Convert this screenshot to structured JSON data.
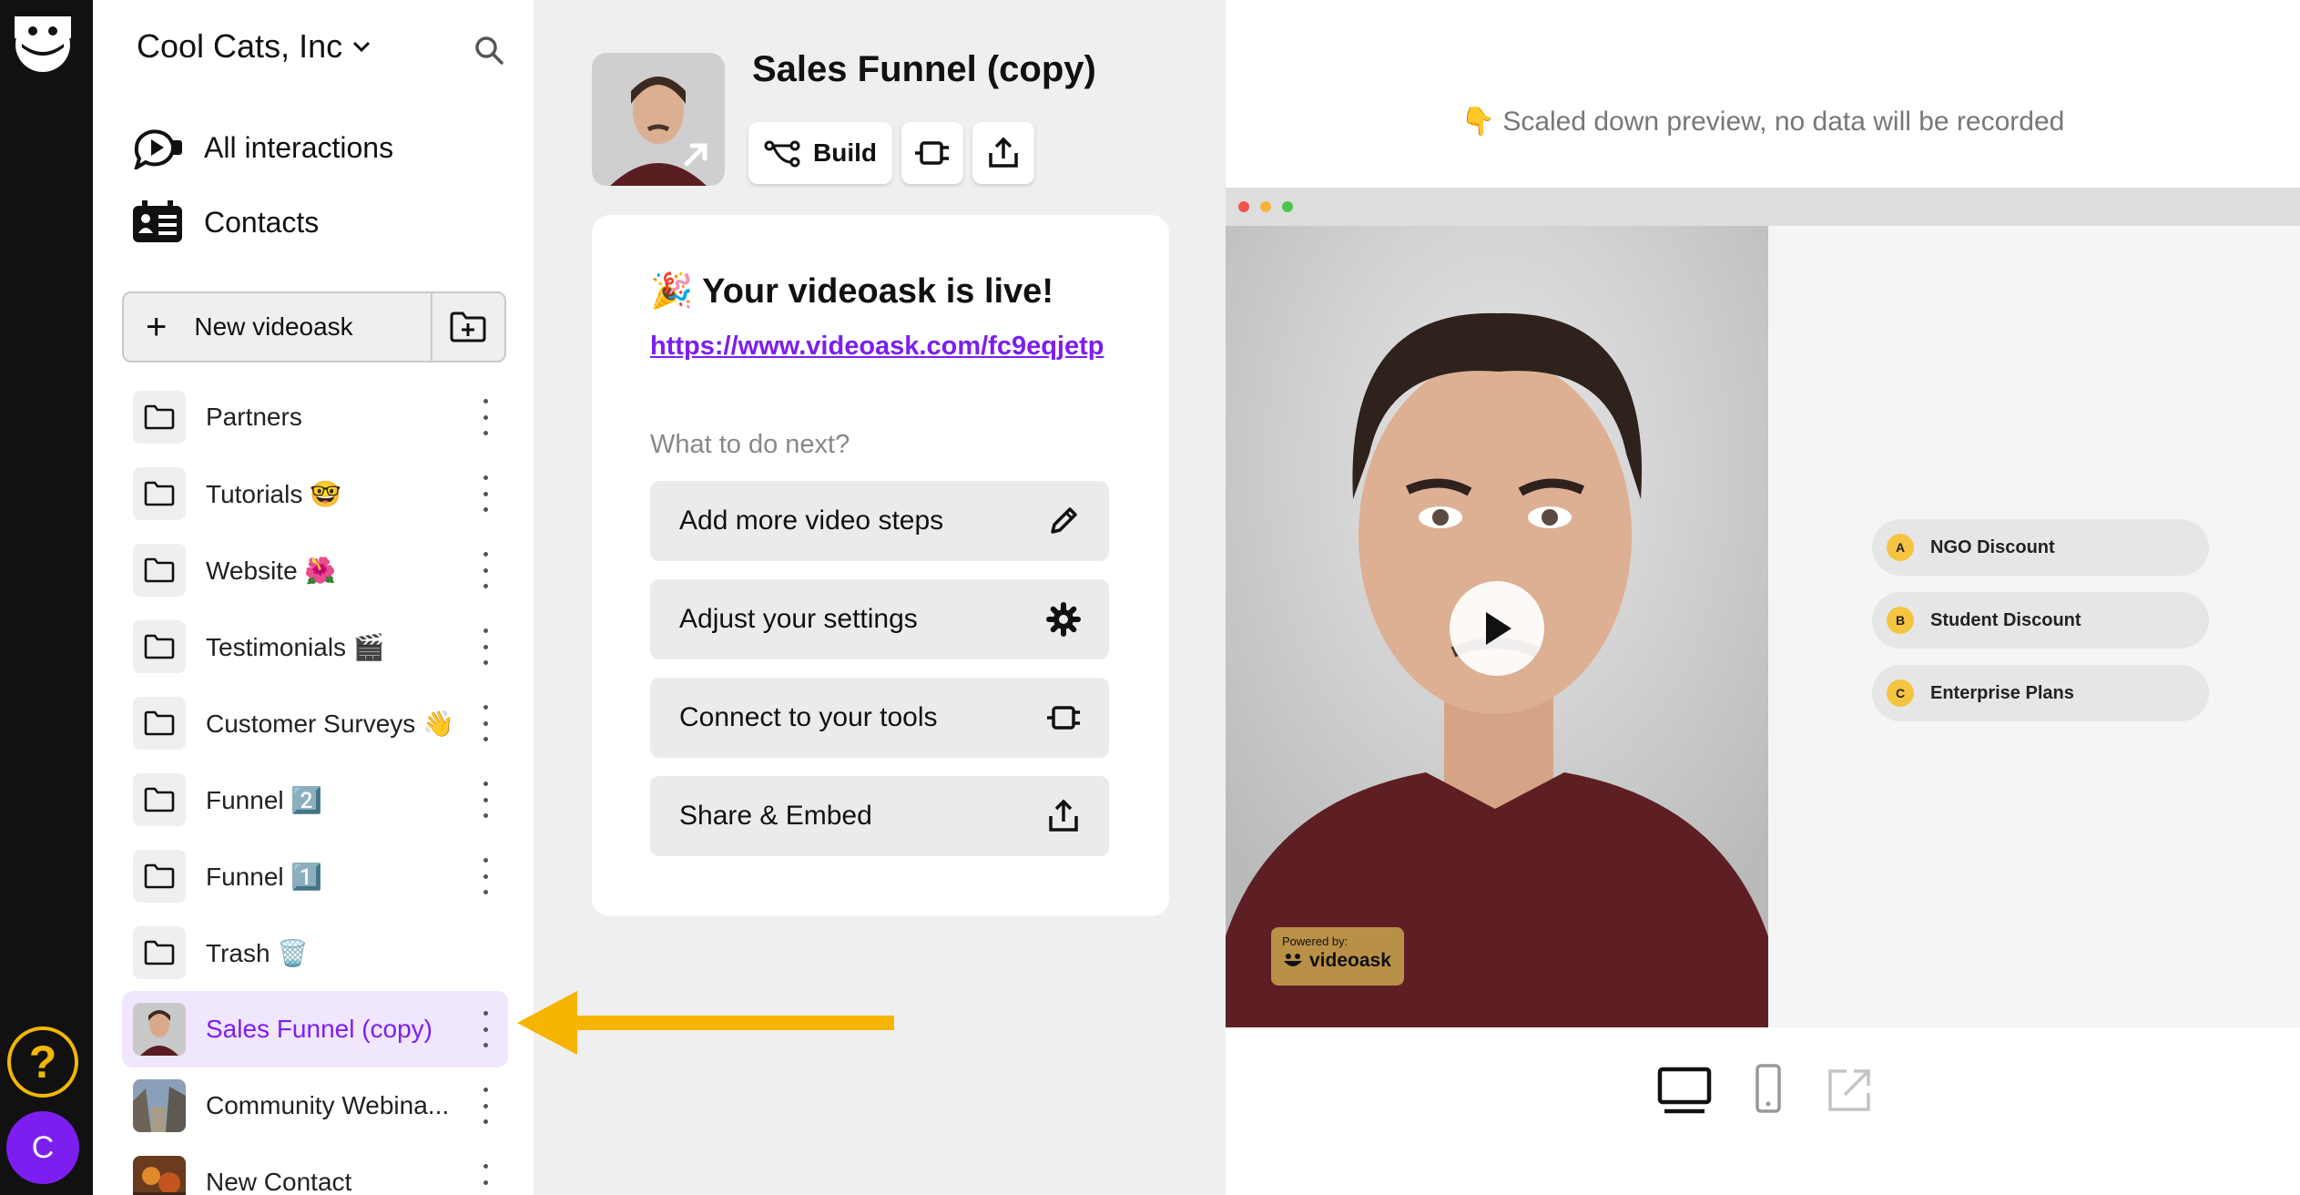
{
  "rail": {
    "help_symbol": "?",
    "avatar_initial": "C"
  },
  "sidebar": {
    "org_name": "Cool Cats, Inc",
    "nav": [
      {
        "label": "All interactions",
        "icon": "interactions-icon"
      },
      {
        "label": "Contacts",
        "icon": "contacts-icon"
      }
    ],
    "new_videoask_label": "New videoask",
    "items": [
      {
        "label": "Partners",
        "type": "folder"
      },
      {
        "label": "Tutorials 🤓",
        "type": "folder"
      },
      {
        "label": "Website 🌺",
        "type": "folder"
      },
      {
        "label": "Testimonials 🎬",
        "type": "folder"
      },
      {
        "label": "Customer Surveys 👋",
        "type": "folder"
      },
      {
        "label": "Funnel 2️⃣",
        "type": "folder"
      },
      {
        "label": "Funnel 1️⃣",
        "type": "folder"
      },
      {
        "label": "Trash 🗑️",
        "type": "folder"
      },
      {
        "label": "Sales Funnel (copy)",
        "type": "videoask",
        "active": true
      },
      {
        "label": "Community Webina...",
        "type": "videoask"
      },
      {
        "label": "New Contact",
        "type": "videoask"
      }
    ]
  },
  "main": {
    "title": "Sales Funnel (copy)",
    "toolbar": {
      "build_label": "Build"
    },
    "card": {
      "live_text": "🎉 Your videoask is live!",
      "link": "https://www.videoask.com/fc9eqjetp",
      "next_heading": "What to do next?",
      "actions": [
        {
          "label": "Add more video steps",
          "icon": "pencil-icon"
        },
        {
          "label": "Adjust your settings",
          "icon": "gear-icon"
        },
        {
          "label": "Connect to your tools",
          "icon": "integration-plug-icon"
        },
        {
          "label": "Share & Embed",
          "icon": "share-upload-icon"
        }
      ]
    }
  },
  "preview": {
    "notice": "👇 Scaled down preview, no data will be recorded",
    "powered_by": "Powered by:",
    "brand": "videoask",
    "choices": [
      {
        "key": "A",
        "label": "NGO Discount"
      },
      {
        "key": "B",
        "label": "Student Discount"
      },
      {
        "key": "C",
        "label": "Enterprise Plans"
      }
    ],
    "devices": [
      "desktop-icon",
      "mobile-icon",
      "open-external-icon"
    ]
  },
  "colors": {
    "accent": "#7c1ef0",
    "help_yellow": "#f2b705",
    "arrow": "#f5b400",
    "rail": "#111111",
    "active_item_bg": "#f0e6fd"
  }
}
